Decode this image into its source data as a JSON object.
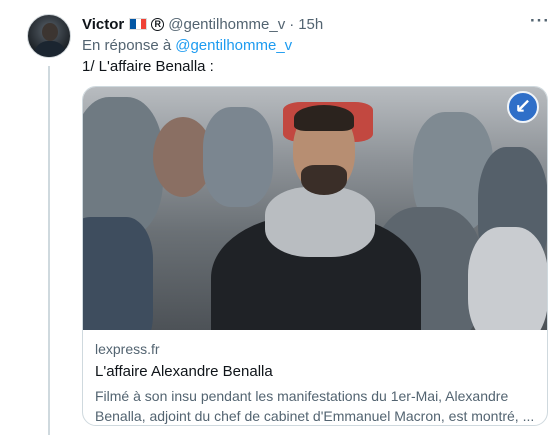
{
  "tweet": {
    "author_name": "Victor",
    "author_handle": "@gentilhomme_v",
    "separator": "·",
    "time": "15h",
    "more_label": "···",
    "reply_prefix": "En réponse à",
    "reply_handle": "@gentilhomme_v",
    "text": "1/ L'affaire Benalla :",
    "flag_colors": [
      "#0055a4",
      "#ffffff",
      "#ef4135"
    ],
    "badge_icon": "circle-r-icon"
  },
  "card": {
    "domain": "lexpress.fr",
    "title": "L'affaire Alexandre Benalla",
    "description_line1": "Filmé à son insu pendant les manifestations du 1er-Mai, Alexandre",
    "description_line2": "Benalla, adjoint du chef de cabinet d'Emmanuel Macron, est montré, ...",
    "image_icon": "news-photo",
    "sign_icon": "blue-arrow-sign-icon",
    "sign_glyph": "↙"
  }
}
